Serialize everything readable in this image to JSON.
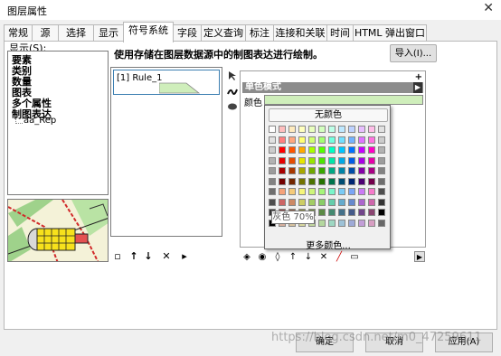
{
  "window": {
    "title": "图层属性",
    "close_glyph": "✕"
  },
  "tabs": [
    "常规",
    "源",
    "选择",
    "显示",
    "符号系统",
    "字段",
    "定义查询",
    "标注",
    "连接和关联",
    "时间",
    "HTML 弹出窗口"
  ],
  "active_tab_index": 4,
  "show_label": "显示(S):",
  "tree": {
    "items": [
      "要素",
      "类别",
      "数量",
      "图表",
      "多个属性",
      "制图表达"
    ],
    "subitem": "aa_Rep"
  },
  "description": "使用存储在图层数据源中的制图表达进行绘制。",
  "import_button": "导入(I)...",
  "rule": {
    "label": "[1] Rule_1"
  },
  "rule_toolbar": {
    "add": "▫",
    "up": "↑",
    "down": "↓",
    "remove": "✕",
    "more": "▸"
  },
  "props": {
    "header": "单色模式",
    "color_label": "颜色",
    "color_value": "#cfeebb",
    "plus": "+",
    "arrow": "▶"
  },
  "color_popup": {
    "no_color": "无颜色",
    "more_colors": "更多颜色...",
    "tooltip": "灰色 70%",
    "swatches": [
      [
        "#ffffff",
        "#ffbebe",
        "#ffebbe",
        "#ffffbe",
        "#e9ffbe",
        "#d3ffbe",
        "#beffe8",
        "#bee8ff",
        "#bed2ff",
        "#e8beff",
        "#ffbee8",
        "#e1e1e1"
      ],
      [
        "#e1e1e1",
        "#ff7f7f",
        "#ffa77f",
        "#ffff73",
        "#d1ff73",
        "#a3ff73",
        "#73ffdf",
        "#73dfff",
        "#73b2ff",
        "#df73ff",
        "#ff73df",
        "#cccccc"
      ],
      [
        "#cccccc",
        "#ff0000",
        "#ff5500",
        "#ffaa00",
        "#aaff00",
        "#55ff00",
        "#00ffc5",
        "#00c5ff",
        "#0070ff",
        "#c500ff",
        "#ff00c5",
        "#b2b2b2"
      ],
      [
        "#b2b2b2",
        "#e60000",
        "#e64c00",
        "#e6e600",
        "#98e600",
        "#4ce600",
        "#00e6a9",
        "#00a9e6",
        "#005ce6",
        "#a900e6",
        "#e600a9",
        "#9c9c9c"
      ],
      [
        "#9c9c9c",
        "#a80000",
        "#a83800",
        "#a8a800",
        "#70a800",
        "#38a800",
        "#00a884",
        "#0084a8",
        "#004da8",
        "#8400a8",
        "#a80084",
        "#828282"
      ],
      [
        "#828282",
        "#730000",
        "#732600",
        "#737300",
        "#4c7300",
        "#267300",
        "#00734c",
        "#004c73",
        "#002673",
        "#4c0073",
        "#73004c",
        "#6e6e6e"
      ],
      [
        "#6e6e6e",
        "#f5a27a",
        "#f5ca7a",
        "#f5f57a",
        "#cdf57a",
        "#a5f57a",
        "#7af5ca",
        "#7acaf5",
        "#7aa5f5",
        "#ca7af5",
        "#f57aca",
        "#4e4e4e"
      ],
      [
        "#4e4e4e",
        "#cd6666",
        "#cd8966",
        "#cdcd66",
        "#a3cd66",
        "#89cd66",
        "#66cdab",
        "#66abcd",
        "#6689cd",
        "#ab66cd",
        "#cd66ab",
        "#343434"
      ],
      [
        "#343434",
        "#894444",
        "#895a44",
        "#898944",
        "#728944",
        "#5a8944",
        "#448970",
        "#447089",
        "#445a89",
        "#704489",
        "#894470",
        "#000000"
      ],
      [
        "#000000",
        "#d7b09e",
        "#d7c29e",
        "#d7d79e",
        "#c2d79e",
        "#b4d79e",
        "#9ed7c2",
        "#9ec2d7",
        "#9eaad7",
        "#c29ed7",
        "#d79ec2",
        "#686868"
      ]
    ]
  },
  "bottom_toolbar": [
    "◈",
    "◉",
    "◊",
    "↑",
    "↓",
    "✕",
    "╱",
    "▭"
  ],
  "buttons": {
    "ok": "确定",
    "cancel": "取消",
    "apply": "应用(A)"
  },
  "watermark": "https://blog.csdn.net/m0_47259611"
}
